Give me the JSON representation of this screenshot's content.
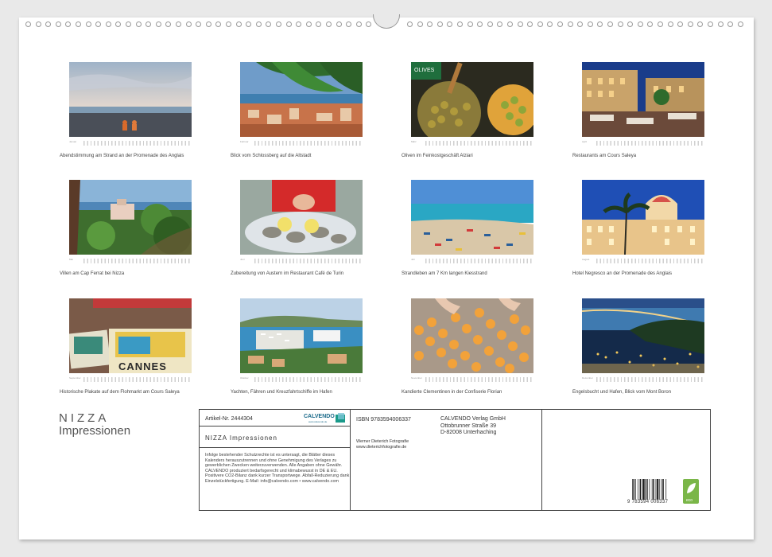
{
  "photos": [
    {
      "month": "Januar",
      "caption": "Abendstimmung am Strand an der Promenade des Anglais",
      "icon": "beach-sunset-photo"
    },
    {
      "month": "Februar",
      "caption": "Blick vom Schlossberg auf die Altstadt",
      "icon": "old-town-photo"
    },
    {
      "month": "März",
      "caption": "Oliven im Feinkostgeschäft Alziari",
      "icon": "olives-photo"
    },
    {
      "month": "April",
      "caption": "Restaurants am Cours Saleya",
      "icon": "restaurants-photo"
    },
    {
      "month": "Mai",
      "caption": "Villen am Cap Ferrat bei Nizza",
      "icon": "villas-photo"
    },
    {
      "month": "Juni",
      "caption": "Zubereitung von Austern im Restaurant Café de Turin",
      "icon": "oysters-photo"
    },
    {
      "month": "Juli",
      "caption": "Strandleben am 7 Km langen Kiesstrand",
      "icon": "beach-life-photo"
    },
    {
      "month": "August",
      "caption": "Hotel Negresco an der Promenade des Anglais",
      "icon": "hotel-photo"
    },
    {
      "month": "September",
      "caption": "Historische Plakate auf dem Flohmarkt am Cours Saleya",
      "icon": "posters-photo"
    },
    {
      "month": "Oktober",
      "caption": "Yachten, Fähren und Kreuzfahrtschiffe im Hafen",
      "icon": "harbour-photo"
    },
    {
      "month": "November",
      "caption": "Kandierte Clementinen in der Confiserie Florian",
      "icon": "clementines-photo"
    },
    {
      "month": "Dezember",
      "caption": "Engelsbucht und Hafen, Blick vom Mont Boron",
      "icon": "bay-night-photo"
    }
  ],
  "poster_text": {
    "cannes": "CANNES",
    "olives": "OLIVES"
  },
  "title": {
    "line1": "NIZZA",
    "line2": "Impressionen"
  },
  "info": {
    "article": "Artikel-Nr. 2444304",
    "logo": "CALVENDO",
    "logo_sub": "www.calvendo.de",
    "product_title": "NIZZA Impressionen",
    "legal": "Infolge bestehender Schutzrechte ist es untersagt, die Blätter dieses Kalenders herauszutrennen und ohne Genehmigung des Verlages zu gewerblichen Zwecken weiterzuverwenden. Alle Angaben ohne Gewähr. CALVENDO produziert bedarfsgerecht und klimabewusst in DE & EU. Positivere CO2-Bilanz dank kurzer Transportwege. Abfall-Reduzierung dank Einzelstückfertigung. E-Mail: info@calvendo.com • www.calvendo.com",
    "isbn": "ISBN 9783594006337",
    "publisher": "CALVENDO Verlag GmbH",
    "street": "Ottobrunner Straße 39",
    "city": "D-82008 Unterhaching",
    "author": "Werner Dieterich Fotografie",
    "author_url": "www.dieterichfotografie.de",
    "barcode_number": "9 783594 006337",
    "eco_label": "eco"
  },
  "colors": {
    "sheet": "#ffffff",
    "background": "#e9e9e9",
    "border": "#444444",
    "eco": "#7ab648",
    "calvendo": "#1a9a8a"
  }
}
